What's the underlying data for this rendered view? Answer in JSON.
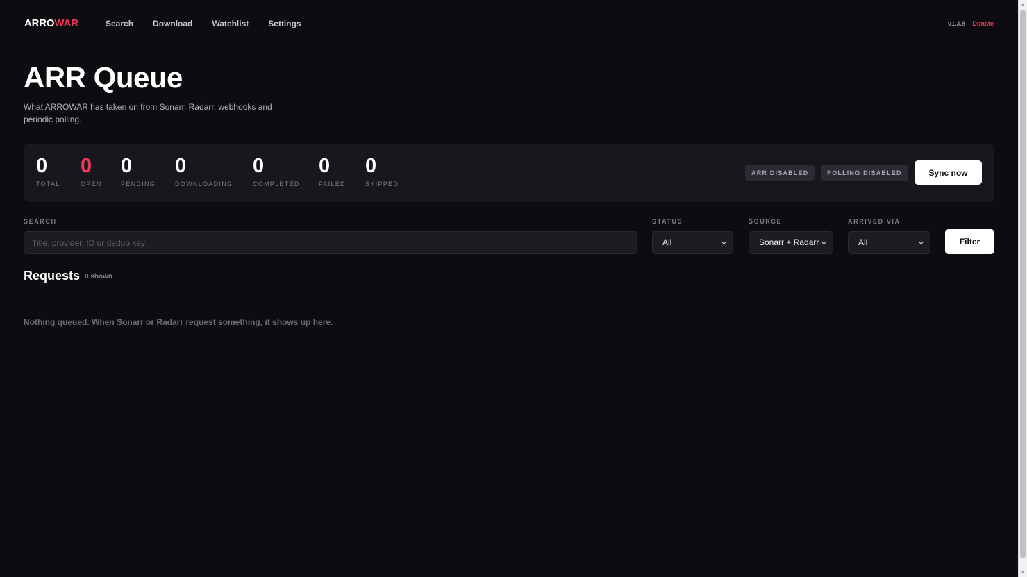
{
  "header": {
    "brand_part1": "ARRO",
    "brand_part2": "WAR",
    "nav": [
      "Search",
      "Download",
      "Watchlist",
      "Settings"
    ],
    "version": "v1.3.8",
    "donate": "Donate"
  },
  "page": {
    "title": "ARR Queue",
    "subtitle": "What ARROWAR has taken on from Sonarr, Radarr, webhooks and periodic polling."
  },
  "stats": [
    {
      "label": "TOTAL",
      "value": "0"
    },
    {
      "label": "OPEN",
      "value": "0"
    },
    {
      "label": "PENDING",
      "value": "0"
    },
    {
      "label": "DOWNLOADING",
      "value": "0"
    },
    {
      "label": "COMPLETED",
      "value": "0"
    },
    {
      "label": "FAILED",
      "value": "0"
    },
    {
      "label": "SKIPPED",
      "value": "0"
    }
  ],
  "status_chips": {
    "arr": "ARR DISABLED",
    "polling": "POLLING DISABLED"
  },
  "sync_label": "Sync now",
  "filters": {
    "search_label": "SEARCH",
    "search_placeholder": "Title, provider, ID or dedup key",
    "search_value": "",
    "status_label": "STATUS",
    "status_value": "All",
    "source_label": "SOURCE",
    "source_value": "Sonarr + Radarr",
    "arrived_label": "ARRIVED VIA",
    "arrived_value": "All",
    "filter_button": "Filter"
  },
  "requests": {
    "title": "Requests",
    "count": "0 shown",
    "empty_message": "Nothing queued. When Sonarr or Radarr request something, it shows up here."
  },
  "colors": {
    "background": "#0d0d11",
    "panel": "#17171d",
    "accent": "#f2385a"
  }
}
